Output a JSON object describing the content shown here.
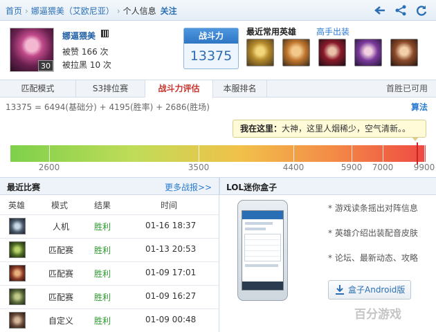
{
  "breadcrumb": {
    "home": "首页",
    "player": "娜逼猥美（艾欧尼亚）",
    "page": "个人信息",
    "follow": "关注"
  },
  "profile": {
    "name": "娜逼猥美",
    "level": "30",
    "likes": "被赞 166 次",
    "blacklisted": "被拉黑 10 次"
  },
  "power": {
    "label": "战斗力",
    "value": "13375"
  },
  "recent_heroes": {
    "title": "最近常用英雄",
    "expert_link": "高手出装"
  },
  "tabs": [
    {
      "label": "匹配模式"
    },
    {
      "label": "S3排位赛"
    },
    {
      "label": "战斗力评估"
    },
    {
      "label": "本服排名"
    }
  ],
  "tabs_right": "首胜已可用",
  "formula": "13375 = 6494(基础分) + 4195(胜率) + 2686(胜场)",
  "algo_link": "算法",
  "tip": {
    "bold": "我在这里：",
    "text": "大神，这里人烟稀少，空气清新。。"
  },
  "scale": {
    "ticks": [
      "2600",
      "3500",
      "4400",
      "5900",
      "7000",
      "9900"
    ],
    "position_pct": 98.0,
    "colors": [
      "#7ed04b",
      "#c0dc58",
      "#f1c14a",
      "#f38a47",
      "#ee4a43"
    ]
  },
  "recent": {
    "title": "最近比赛",
    "more": "更多战报>>",
    "columns": [
      "英雄",
      "模式",
      "结果",
      "时间"
    ],
    "rows": [
      {
        "mode": "人机",
        "result": "胜利",
        "time": "01-16 18:37"
      },
      {
        "mode": "匹配赛",
        "result": "胜利",
        "time": "01-13 20:53"
      },
      {
        "mode": "匹配赛",
        "result": "胜利",
        "time": "01-09 17:01"
      },
      {
        "mode": "匹配赛",
        "result": "胜利",
        "time": "01-09 16:27"
      },
      {
        "mode": "自定义",
        "result": "胜利",
        "time": "01-09 00:48"
      }
    ]
  },
  "box": {
    "title": "LOL迷你盒子",
    "features": [
      "* 游戏读条摇出对阵信息",
      "* 英雄介绍出装配音皮肤",
      "* 论坛、最新动态、攻略"
    ],
    "download": "盒子Android版"
  },
  "watermark": "百分游戏"
}
